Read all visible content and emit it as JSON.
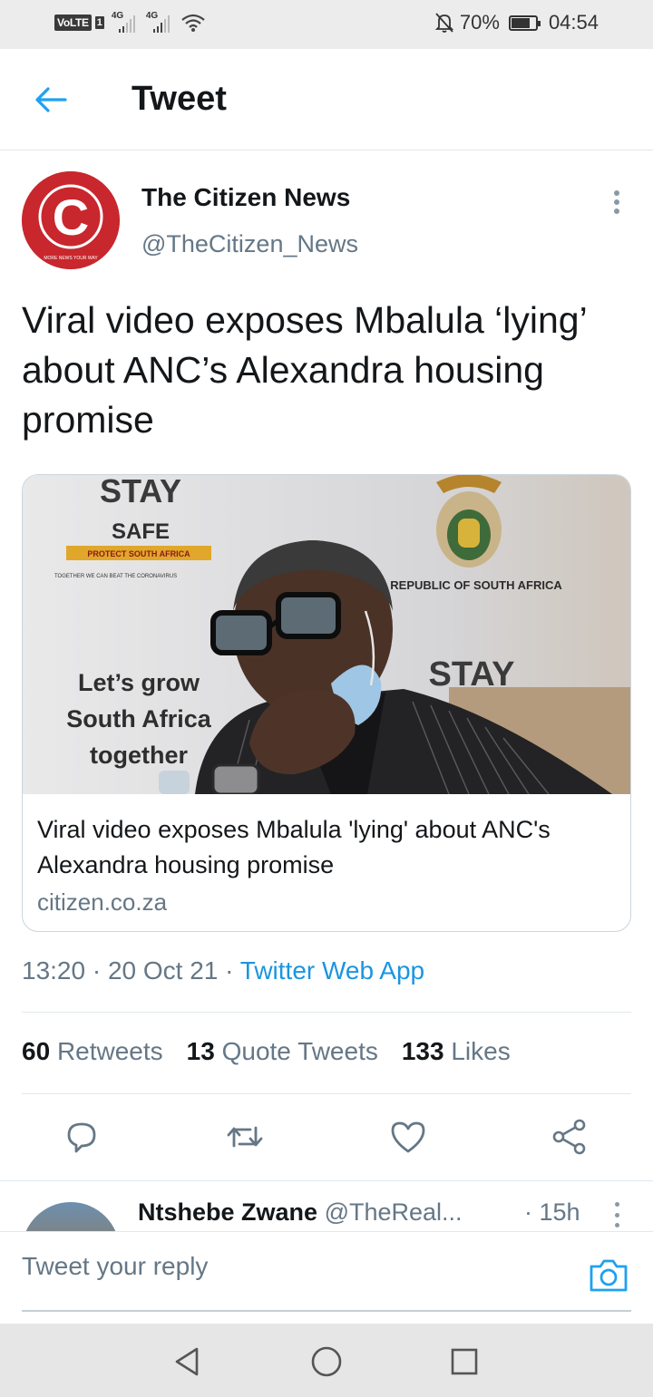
{
  "status_bar": {
    "volte": "VoLTE",
    "sim": "1",
    "net1": "4G",
    "net2": "4G",
    "battery_pct": "70%",
    "battery_level": 0.7,
    "time": "04:54"
  },
  "header": {
    "title": "Tweet"
  },
  "tweet": {
    "author_name": "The Citizen News",
    "author_handle": "@TheCitizen_News",
    "avatar_letter": "C",
    "avatar_tagline": "MORE NEWS YOUR WAY",
    "text": "Viral video exposes Mbalula ‘lying’ about ANC’s Alexandra housing promise",
    "card": {
      "title": "Viral video exposes Mbalula 'lying' about ANC's Alexandra housing promise",
      "domain": "citizen.co.za",
      "image_text": {
        "stay": "STAY",
        "safe": "SAFE",
        "protect": "PROTECT SOUTH AFRICA",
        "together_line": "TOGETHER WE CAN BEAT THE CORONAVIRUS",
        "republic": "REPUBLIC OF SOUTH AFRICA",
        "grow_1": "Let’s grow",
        "grow_2": "South Africa",
        "grow_3": "together",
        "stay2": "STAY"
      }
    },
    "time": "13:20",
    "date": "20 Oct 21",
    "source": "Twitter Web App",
    "stats": {
      "retweets_count": "60",
      "retweets_label": "Retweets",
      "quotes_count": "13",
      "quotes_label": "Quote Tweets",
      "likes_count": "133",
      "likes_label": "Likes"
    }
  },
  "reply_preview": {
    "name": "Ntshebe Zwane",
    "handle": "@TheReal...",
    "time": "· 15h"
  },
  "composer": {
    "placeholder": "Tweet your reply"
  },
  "colors": {
    "accent": "#1da1f2",
    "text": "#14171a",
    "secondary": "#657786",
    "brand_red": "#c8272d"
  }
}
